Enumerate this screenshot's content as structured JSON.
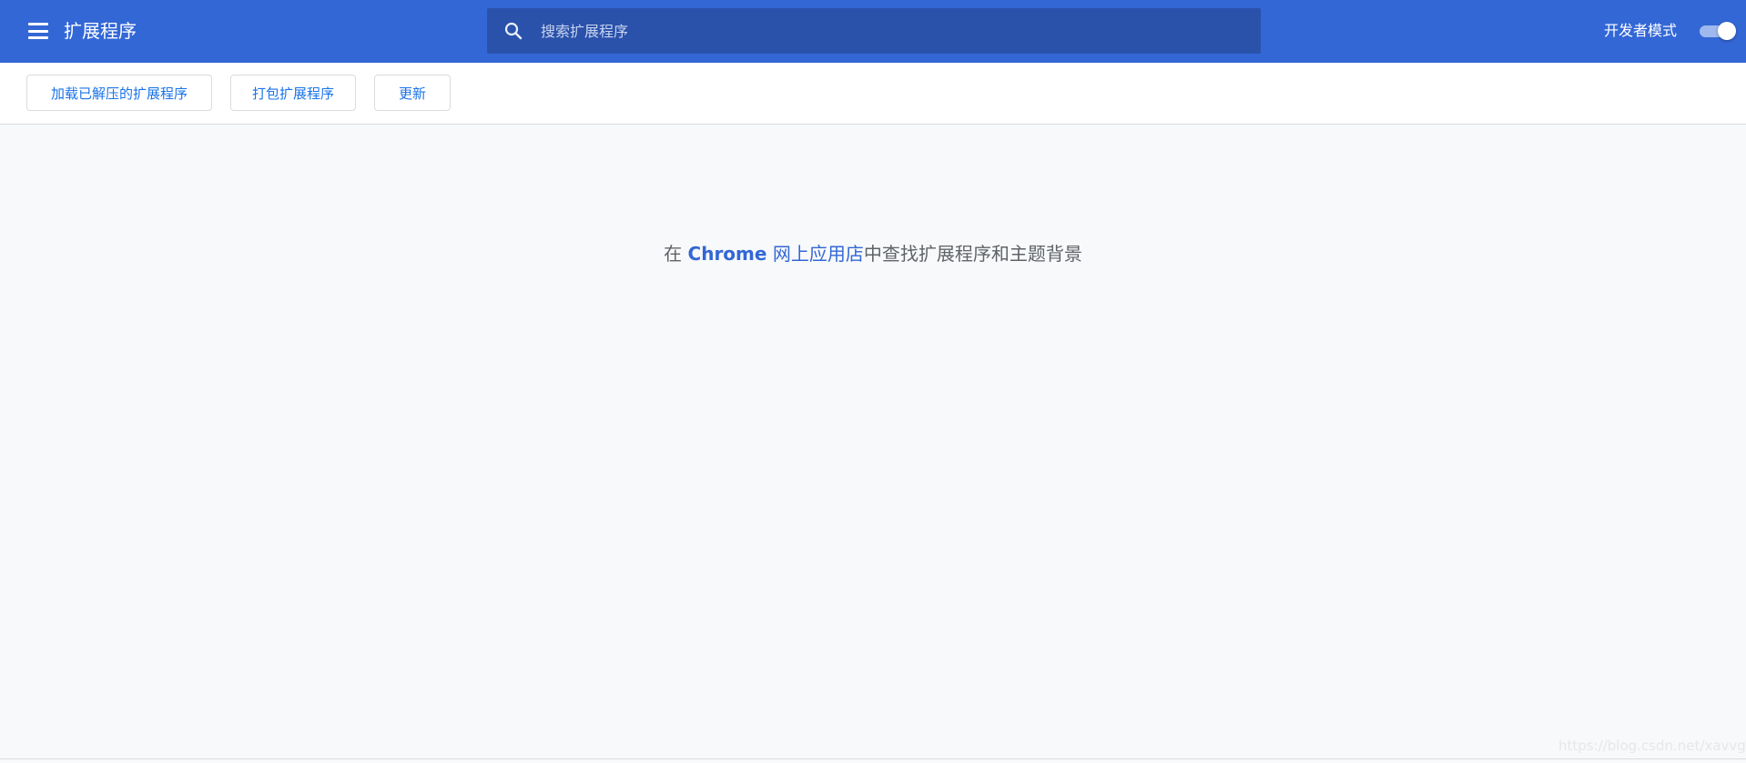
{
  "header": {
    "title": "扩展程序",
    "menu_icon": "hamburger-menu-icon",
    "search": {
      "placeholder": "搜索扩展程序",
      "value": "",
      "icon": "search-icon"
    },
    "developer_mode": {
      "label": "开发者模式",
      "enabled": true
    }
  },
  "toolbar": {
    "load_unpacked_label": "加载已解压的扩展程序",
    "pack_extension_label": "打包扩展程序",
    "update_label": "更新"
  },
  "main": {
    "message_prefix": "在 ",
    "store_brand": "Chrome",
    "store_name": " 网上应用店",
    "message_suffix": "中查找扩展程序和主题背景"
  },
  "watermark": "https://blog.csdn.net/xavvgu",
  "colors": {
    "header_bg": "#3367d6",
    "search_bg": "#2a52ab",
    "button_text": "#1a73e8",
    "page_bg": "#f8f9fa",
    "link": "#3367d6"
  }
}
